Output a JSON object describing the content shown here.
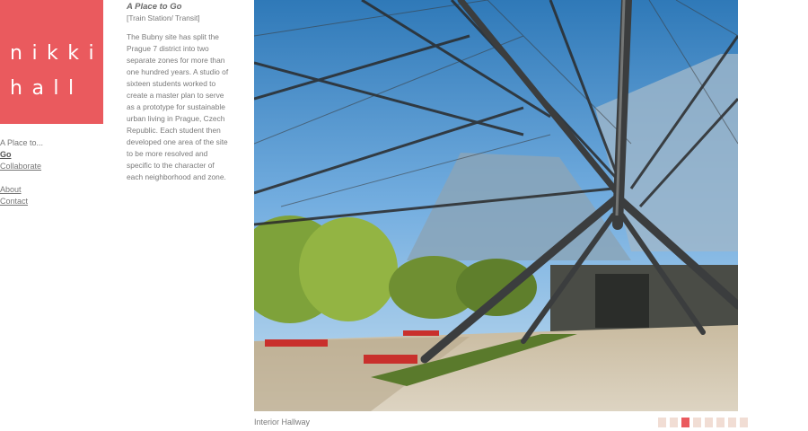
{
  "logo": {
    "line1": "nikki",
    "line2": "hall"
  },
  "nav": {
    "intro": "A Place to...",
    "items": [
      {
        "label": "Go",
        "active": true
      },
      {
        "label": "Collaborate",
        "active": false
      }
    ],
    "secondary": [
      {
        "label": "About"
      },
      {
        "label": "Contact"
      }
    ]
  },
  "project": {
    "title": "A Place to Go",
    "subtitle": "[Train Station/ Transit]",
    "description": "The Bubny site has split the Prague 7 district into two separate zones for more than one hundred years. A studio of sixteen students worked to create a master plan to serve as a prototype for sustainable urban living in Prague, Czech Republic. Each student then developed one area of the site to be more resolved and specific to the character of each neighborhood and zone."
  },
  "photo": {
    "caption": "Interior Hallway"
  },
  "pager": {
    "count": 8,
    "active_index": 2
  },
  "colors": {
    "accent": "#ea5a5e",
    "pager_inactive": "#f1ddd4"
  }
}
